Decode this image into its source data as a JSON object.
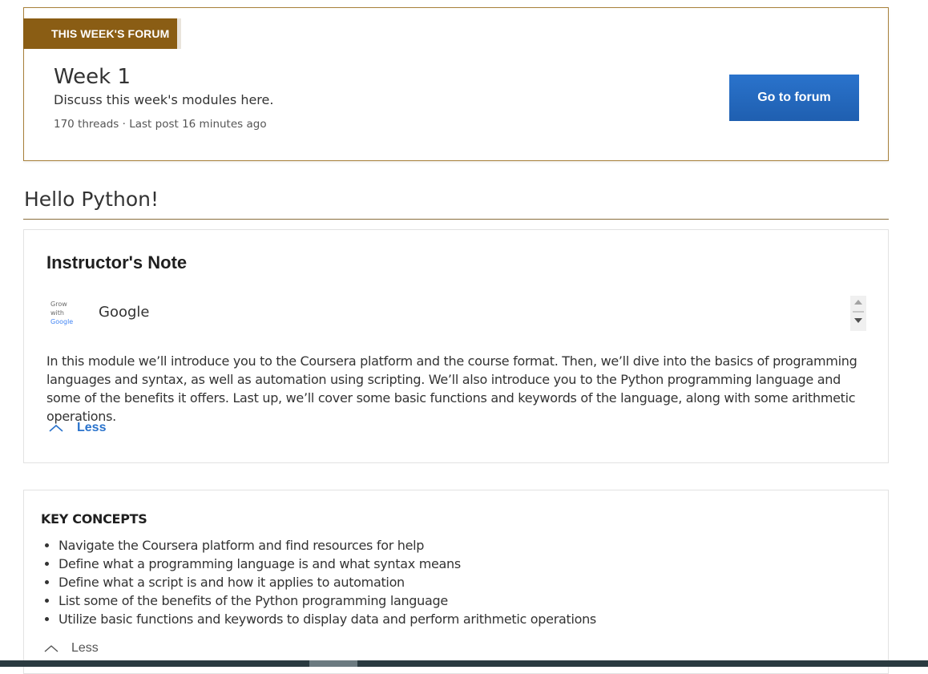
{
  "forum": {
    "ribbon": "THIS WEEK'S FORUM",
    "title": "Week 1",
    "description": "Discuss this week's modules here.",
    "meta": "170 threads · Last post 16 minutes ago",
    "button_label": "Go to forum"
  },
  "section": {
    "title": "Hello Python!"
  },
  "instructor_note": {
    "title": "Instructor's Note",
    "logo_lines": [
      "Grow",
      "with",
      "Google"
    ],
    "instructor_name": "Google",
    "body": "In this module we’ll introduce you to the Coursera platform and the course format. Then, we’ll dive into the basics of programming languages and syntax, as well as automation using scripting. We’ll also introduce you to the Python programming language and some of the benefits it offers. Last up, we’ll cover some basic functions and keywords of the language, along with some arithmetic operations.",
    "toggle_label": "Less",
    "toggle_icon": "chevron-up-icon"
  },
  "key_concepts": {
    "title": "KEY CONCEPTS",
    "items": [
      "Navigate the Coursera platform and find resources for help",
      "Define what a programming language is and what syntax means",
      "Define what a script is and how it applies to automation",
      "List some of the benefits of the Python programming language",
      "Utilize basic functions and keywords to display data and perform arithmetic operations"
    ],
    "toggle_label": "Less",
    "toggle_icon": "chevron-up-icon"
  },
  "colors": {
    "accent_gold": "#8a5d14",
    "button_blue": "#1f5fb0",
    "link_blue": "#2a73cc"
  }
}
